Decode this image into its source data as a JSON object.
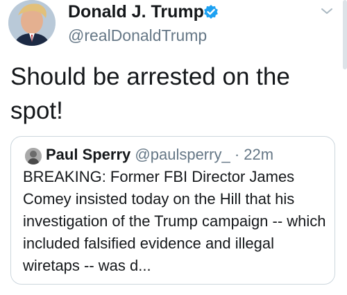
{
  "tweet": {
    "author": {
      "name": "Donald J. Trump",
      "handle": "@realDonaldTrump",
      "verified": true
    },
    "text": "Should be arrested on the spot!",
    "quoted": {
      "author_name": "Paul Sperry",
      "handle": "@paulsperry_",
      "separator": "·",
      "time": "22m",
      "text": "BREAKING: Former FBI Director James Comey insisted today on the Hill that his investigation of the Trump campaign -- which included falsified evidence and illegal wiretaps -- was d..."
    }
  },
  "icons": {
    "verified": "verified-badge-icon",
    "caret": "chevron-down-icon"
  },
  "colors": {
    "text": "#14171a",
    "secondary": "#657786",
    "verified": "#1da1f2",
    "border": "#ccd6dd"
  }
}
